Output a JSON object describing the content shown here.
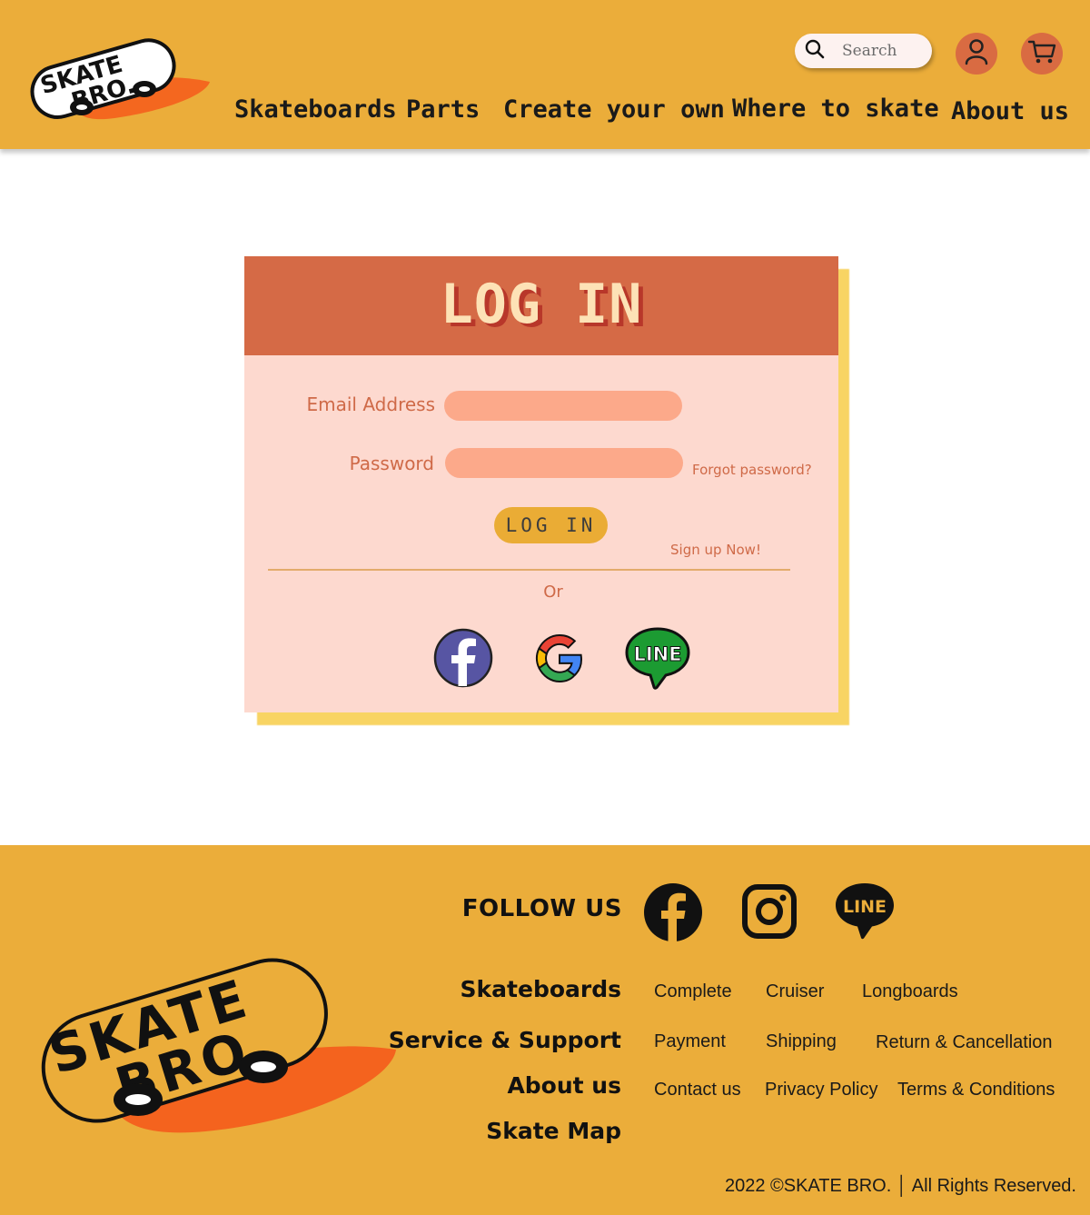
{
  "header": {
    "search_placeholder": "Search",
    "nav": [
      "Skateboards",
      "Parts",
      "Create your own",
      "Where to skate",
      "About us"
    ],
    "logo_text_line1": "SKATE",
    "logo_text_line2": "BRO."
  },
  "login": {
    "title": "LOG IN",
    "email_label": "Email Address",
    "email_value": "",
    "password_label": "Password",
    "password_value": "",
    "forgot_password": "Forgot password?",
    "button_label": "LOG IN",
    "signup_link": "Sign up Now!",
    "or_text": "Or",
    "social": [
      "facebook-icon",
      "google-icon",
      "line-icon"
    ]
  },
  "footer": {
    "follow_us": "FOLLOW US",
    "social": [
      "facebook-icon",
      "instagram-icon",
      "line-icon"
    ],
    "sections": [
      {
        "heading": "Skateboards",
        "links": [
          "Complete",
          "Cruiser",
          "Longboards"
        ]
      },
      {
        "heading": "Service & Support",
        "links": [
          "Payment",
          "Shipping",
          "Return & Cancellation"
        ]
      },
      {
        "heading": "About us",
        "links": [
          "Contact us",
          "Privacy Policy",
          "Terms & Conditions"
        ]
      },
      {
        "heading": "Skate Map",
        "links": []
      }
    ],
    "copyright": "2022 ©SKATE BRO.  │  All Rights Reserved."
  },
  "colors": {
    "header_bg": "#ebad3a",
    "card_header": "#d56a46",
    "card_bg": "#fdd9cf",
    "input_bg": "#fca98a",
    "accent_text": "#cf6a48",
    "card_shadow": "#f8d463"
  }
}
